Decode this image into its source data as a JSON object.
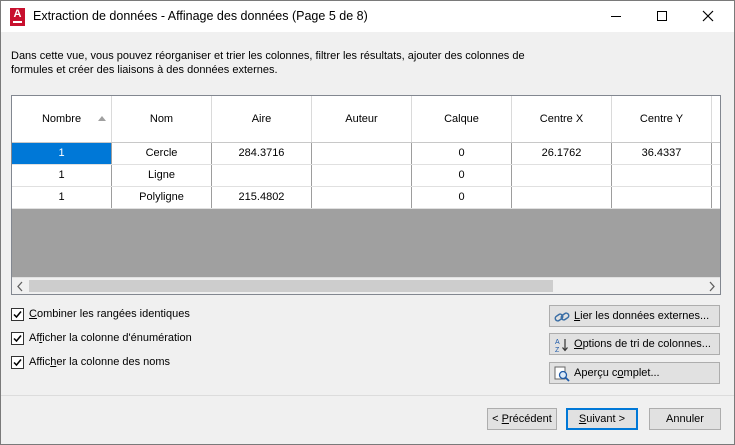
{
  "window": {
    "title": "Extraction de données - Affinage des données (Page 5 de 8)",
    "app_icon_letter": "A",
    "accent": "#c8102e"
  },
  "description": "Dans cette vue, vous pouvez réorganiser et trier les colonnes, filtrer les résultats, ajouter des colonnes de formules et créer des liaisons à des données externes.",
  "table": {
    "columns": [
      "Nombre",
      "Nom",
      "Aire",
      "Auteur",
      "Calque",
      "Centre X",
      "Centre Y"
    ],
    "sort_column": "Nombre",
    "rows": [
      [
        "1",
        "Cercle",
        "284.3716",
        "",
        "0",
        "26.1762",
        "36.4337"
      ],
      [
        "1",
        "Ligne",
        "",
        "",
        "0",
        "",
        ""
      ],
      [
        "1",
        "Polyligne",
        "215.4802",
        "",
        "0",
        "",
        ""
      ]
    ],
    "selection_color": "#0078d7"
  },
  "options": {
    "combine": {
      "label_u": "C",
      "label_rest": "ombiner les rangées identiques",
      "checked": true
    },
    "enum": {
      "label_pre": "Af",
      "label_u": "f",
      "label_rest": "icher la colonne d'énumération",
      "checked": true
    },
    "names": {
      "label_pre": "Affic",
      "label_u": "h",
      "label_rest": "er la colonne des noms",
      "checked": true
    }
  },
  "side_buttons": {
    "link": {
      "u": "L",
      "rest": "ier les données externes...",
      "icon": "link-icon"
    },
    "sort": {
      "u": "O",
      "rest": "ptions de tri de colonnes...",
      "icon": "sort-az-icon"
    },
    "preview": {
      "pre": "Aperçu c",
      "u": "o",
      "rest": "mplet...",
      "icon": "magnifier-icon"
    }
  },
  "footer": {
    "prev": {
      "pre": "< ",
      "u": "P",
      "rest": "récédent"
    },
    "next": {
      "u": "S",
      "rest": "uivant >"
    },
    "cancel": "Annuler"
  }
}
